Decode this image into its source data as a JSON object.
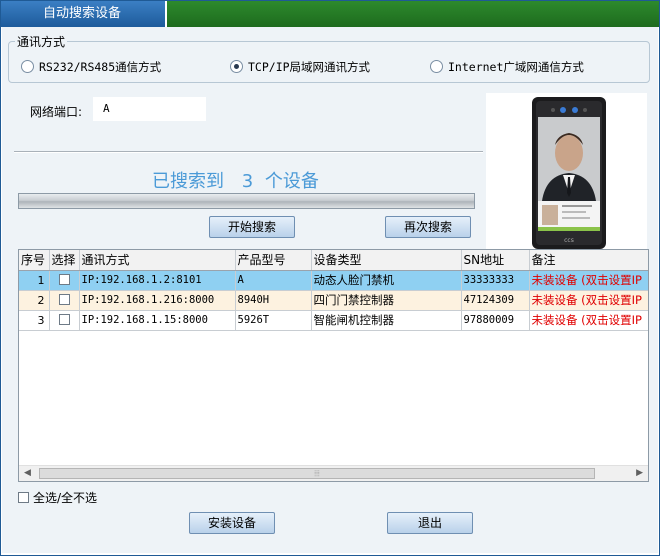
{
  "window": {
    "title": "自动搜索设备"
  },
  "comm_group": {
    "legend": "通讯方式",
    "options": [
      {
        "label": "RS232/RS485通信方式",
        "checked": false
      },
      {
        "label": "TCP/IP局域网通讯方式",
        "checked": true
      },
      {
        "label": "Internet广域网通信方式",
        "checked": false
      }
    ]
  },
  "port": {
    "label": "网络端口:",
    "value": "A"
  },
  "search": {
    "status_prefix": "已搜索到",
    "count": "3",
    "status_suffix": "个设备",
    "start_label": "开始搜索",
    "again_label": "再次搜索"
  },
  "table": {
    "columns": [
      "序号",
      "选择",
      "通讯方式",
      "产品型号",
      "设备类型",
      "SN地址",
      "备注"
    ],
    "rows": [
      {
        "index": "1",
        "checked": false,
        "comm": "IP:192.168.1.2:8101",
        "model": "A",
        "type": "动态人脸门禁机",
        "sn": "33333333",
        "note": "未装设备 (双击设置IP"
      },
      {
        "index": "2",
        "checked": false,
        "comm": "IP:192.168.1.216:8000",
        "model": "8940H",
        "type": "四门门禁控制器",
        "sn": "47124309",
        "note": "未装设备 (双击设置IP"
      },
      {
        "index": "3",
        "checked": false,
        "comm": "IP:192.168.1.15:8000",
        "model": "5926T",
        "type": "智能闸机控制器",
        "sn": "97880009",
        "note": "未装设备 (双击设置IP"
      }
    ]
  },
  "footer": {
    "select_all_label": "全选/全不选",
    "install_label": "安装设备",
    "exit_label": "退出"
  },
  "device_photo": {
    "screen_text_top": "Hi Martin",
    "screen_text_id": "0012345678",
    "screen_time": "16:53:41",
    "brand": "ccs"
  }
}
